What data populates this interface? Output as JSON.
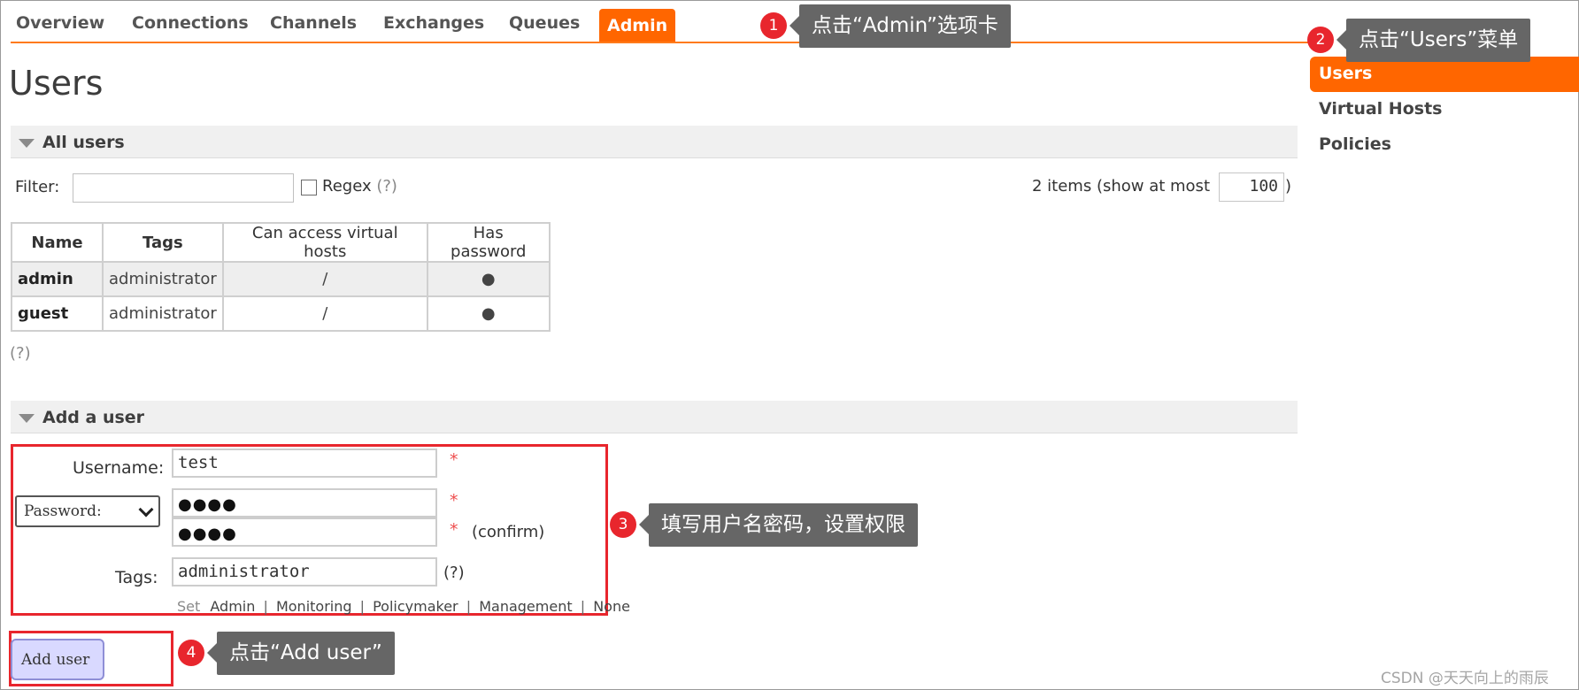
{
  "nav": {
    "tabs": [
      "Overview",
      "Connections",
      "Channels",
      "Exchanges",
      "Queues",
      "Admin"
    ],
    "active": "Admin"
  },
  "page_title": "Users",
  "sidebar": {
    "items": [
      "Users",
      "Virtual Hosts",
      "Policies"
    ],
    "active": "Users"
  },
  "all_users": {
    "header": "All users",
    "filter_label": "Filter:",
    "filter_value": "",
    "regex_label": "Regex",
    "regex_help": "(?)",
    "items_text": "2 items (show at most",
    "items_max": "100",
    "items_close": ")",
    "columns": [
      "Name",
      "Tags",
      "Can access virtual hosts",
      "Has password"
    ],
    "rows": [
      {
        "name": "admin",
        "tags": "administrator",
        "vhosts": "/",
        "has_password": "●"
      },
      {
        "name": "guest",
        "tags": "administrator",
        "vhosts": "/",
        "has_password": "●"
      }
    ],
    "help": "(?)"
  },
  "add_user": {
    "header": "Add a user",
    "username_label": "Username:",
    "username_value": "test",
    "required_mark": "*",
    "password_mode": "Password:",
    "password_mask": "●●●●",
    "confirm_mask": "●●●●",
    "confirm_label": "(confirm)",
    "tags_label": "Tags:",
    "tags_value": "administrator",
    "tags_help": "(?)",
    "set_label": "Set",
    "tag_options": [
      "Admin",
      "Monitoring",
      "Policymaker",
      "Management",
      "None"
    ],
    "tag_sep": "|",
    "submit_label": "Add user"
  },
  "callouts": [
    {
      "num": "1",
      "text": "点击“Admin”选项卡"
    },
    {
      "num": "2",
      "text": "点击“Users”菜单"
    },
    {
      "num": "3",
      "text": "填写用户名密码，设置权限"
    },
    {
      "num": "4",
      "text": "点击“Add user”"
    }
  ],
  "watermark": "CSDN @天天向上的雨辰",
  "colors": {
    "accent": "#ff6600",
    "callout_bg": "#666666",
    "highlight_red": "#e8262d",
    "button_bg": "#d9d9ff"
  }
}
